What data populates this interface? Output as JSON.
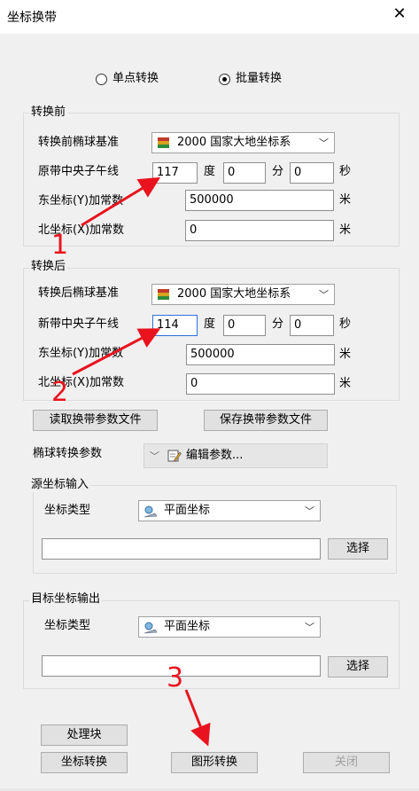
{
  "window": {
    "title": "坐标换带",
    "close_icon": "close-icon"
  },
  "mode": {
    "single_label": "单点转换",
    "batch_label": "批量转换",
    "selected": "batch"
  },
  "before": {
    "legend": "转换前",
    "ellipsoid_label": "转换前椭球基准",
    "ellipsoid_value": "2000 国家大地坐标系",
    "meridian_label": "原带中央子午线",
    "deg": "117",
    "deg_unit": "度",
    "min": "0",
    "min_unit": "分",
    "sec": "0",
    "sec_unit": "秒",
    "east_label": "东坐标(Y)加常数",
    "east_value": "500000",
    "east_unit": "米",
    "north_label": "北坐标(X)加常数",
    "north_value": "0",
    "north_unit": "米"
  },
  "after": {
    "legend": "转换后",
    "ellipsoid_label": "转换后椭球基准",
    "ellipsoid_value": "2000 国家大地坐标系",
    "meridian_label": "新带中央子午线",
    "deg": "114",
    "deg_unit": "度",
    "min": "0",
    "min_unit": "分",
    "sec": "0",
    "sec_unit": "秒",
    "east_label": "东坐标(Y)加常数",
    "east_value": "500000",
    "east_unit": "米",
    "north_label": "北坐标(X)加常数",
    "north_value": "0",
    "north_unit": "米"
  },
  "param_buttons": {
    "read": "读取换带参数文件",
    "save": "保存换带参数文件"
  },
  "ellipsoid_params": {
    "label": "椭球转换参数",
    "button": "编辑参数..."
  },
  "source": {
    "legend": "源坐标输入",
    "type_label": "坐标类型",
    "type_value": "平面坐标",
    "path_value": "",
    "select_button": "选择"
  },
  "target": {
    "legend": "目标坐标输出",
    "type_label": "坐标类型",
    "type_value": "平面坐标",
    "path_value": "",
    "select_button": "选择"
  },
  "actions": {
    "process_block": "处理块",
    "coord_convert": "坐标转换",
    "graphic_convert": "图形转换",
    "close": "关闭"
  },
  "annotations": {
    "step1": "1",
    "step2": "2",
    "step3": "3",
    "arrow_color": "#e8131e"
  }
}
